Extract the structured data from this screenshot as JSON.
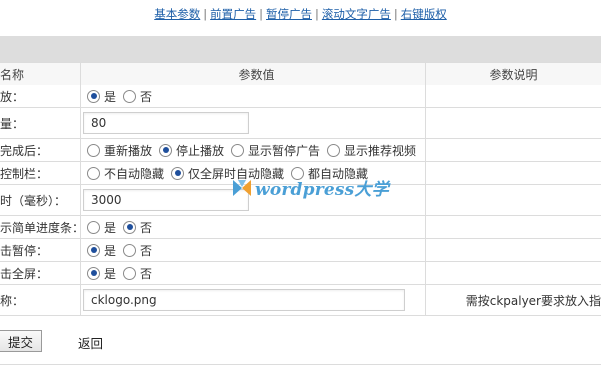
{
  "nav": {
    "links": [
      "基本参数",
      "前置广告",
      "暂停广告",
      "滚动文字广告",
      "右键版权"
    ],
    "separator": "|"
  },
  "table": {
    "header": {
      "label": "名称",
      "value": "参数值",
      "desc": "参数说明"
    },
    "rows": [
      {
        "label": "放：",
        "options": [
          "是",
          "否"
        ],
        "selected": 0
      },
      {
        "label": "量：",
        "input": "80"
      },
      {
        "label": "完成后：",
        "options": [
          "重新播放",
          "停止播放",
          "显示暂停广告",
          "显示推荐视频"
        ],
        "selected": 1
      },
      {
        "label": "控制栏：",
        "options": [
          "不自动隐藏",
          "仅全屏时自动隐藏",
          "都自动隐藏"
        ],
        "selected": 1
      },
      {
        "label": "时（毫秒）：",
        "input": "3000"
      },
      {
        "label": "示简单进度条：",
        "options": [
          "是",
          "否"
        ],
        "selected": 1
      },
      {
        "label": "击暂停：",
        "options": [
          "是",
          "否"
        ],
        "selected": 0
      },
      {
        "label": "击全屏：",
        "options": [
          "是",
          "否"
        ],
        "selected": 0
      },
      {
        "label": "称：",
        "input": "cklogo.png",
        "desc": "需按ckpalyer要求放入指"
      }
    ]
  },
  "actions": {
    "submit": "提交",
    "back": "返回"
  },
  "watermark": {
    "text": "wordpress大学",
    "accent": "#4a9fd6",
    "accent2": "#f0a030"
  },
  "colors": {
    "link": "#1e5fa8",
    "radio_selected": "#1f4f9c",
    "band": "#dddddd"
  }
}
